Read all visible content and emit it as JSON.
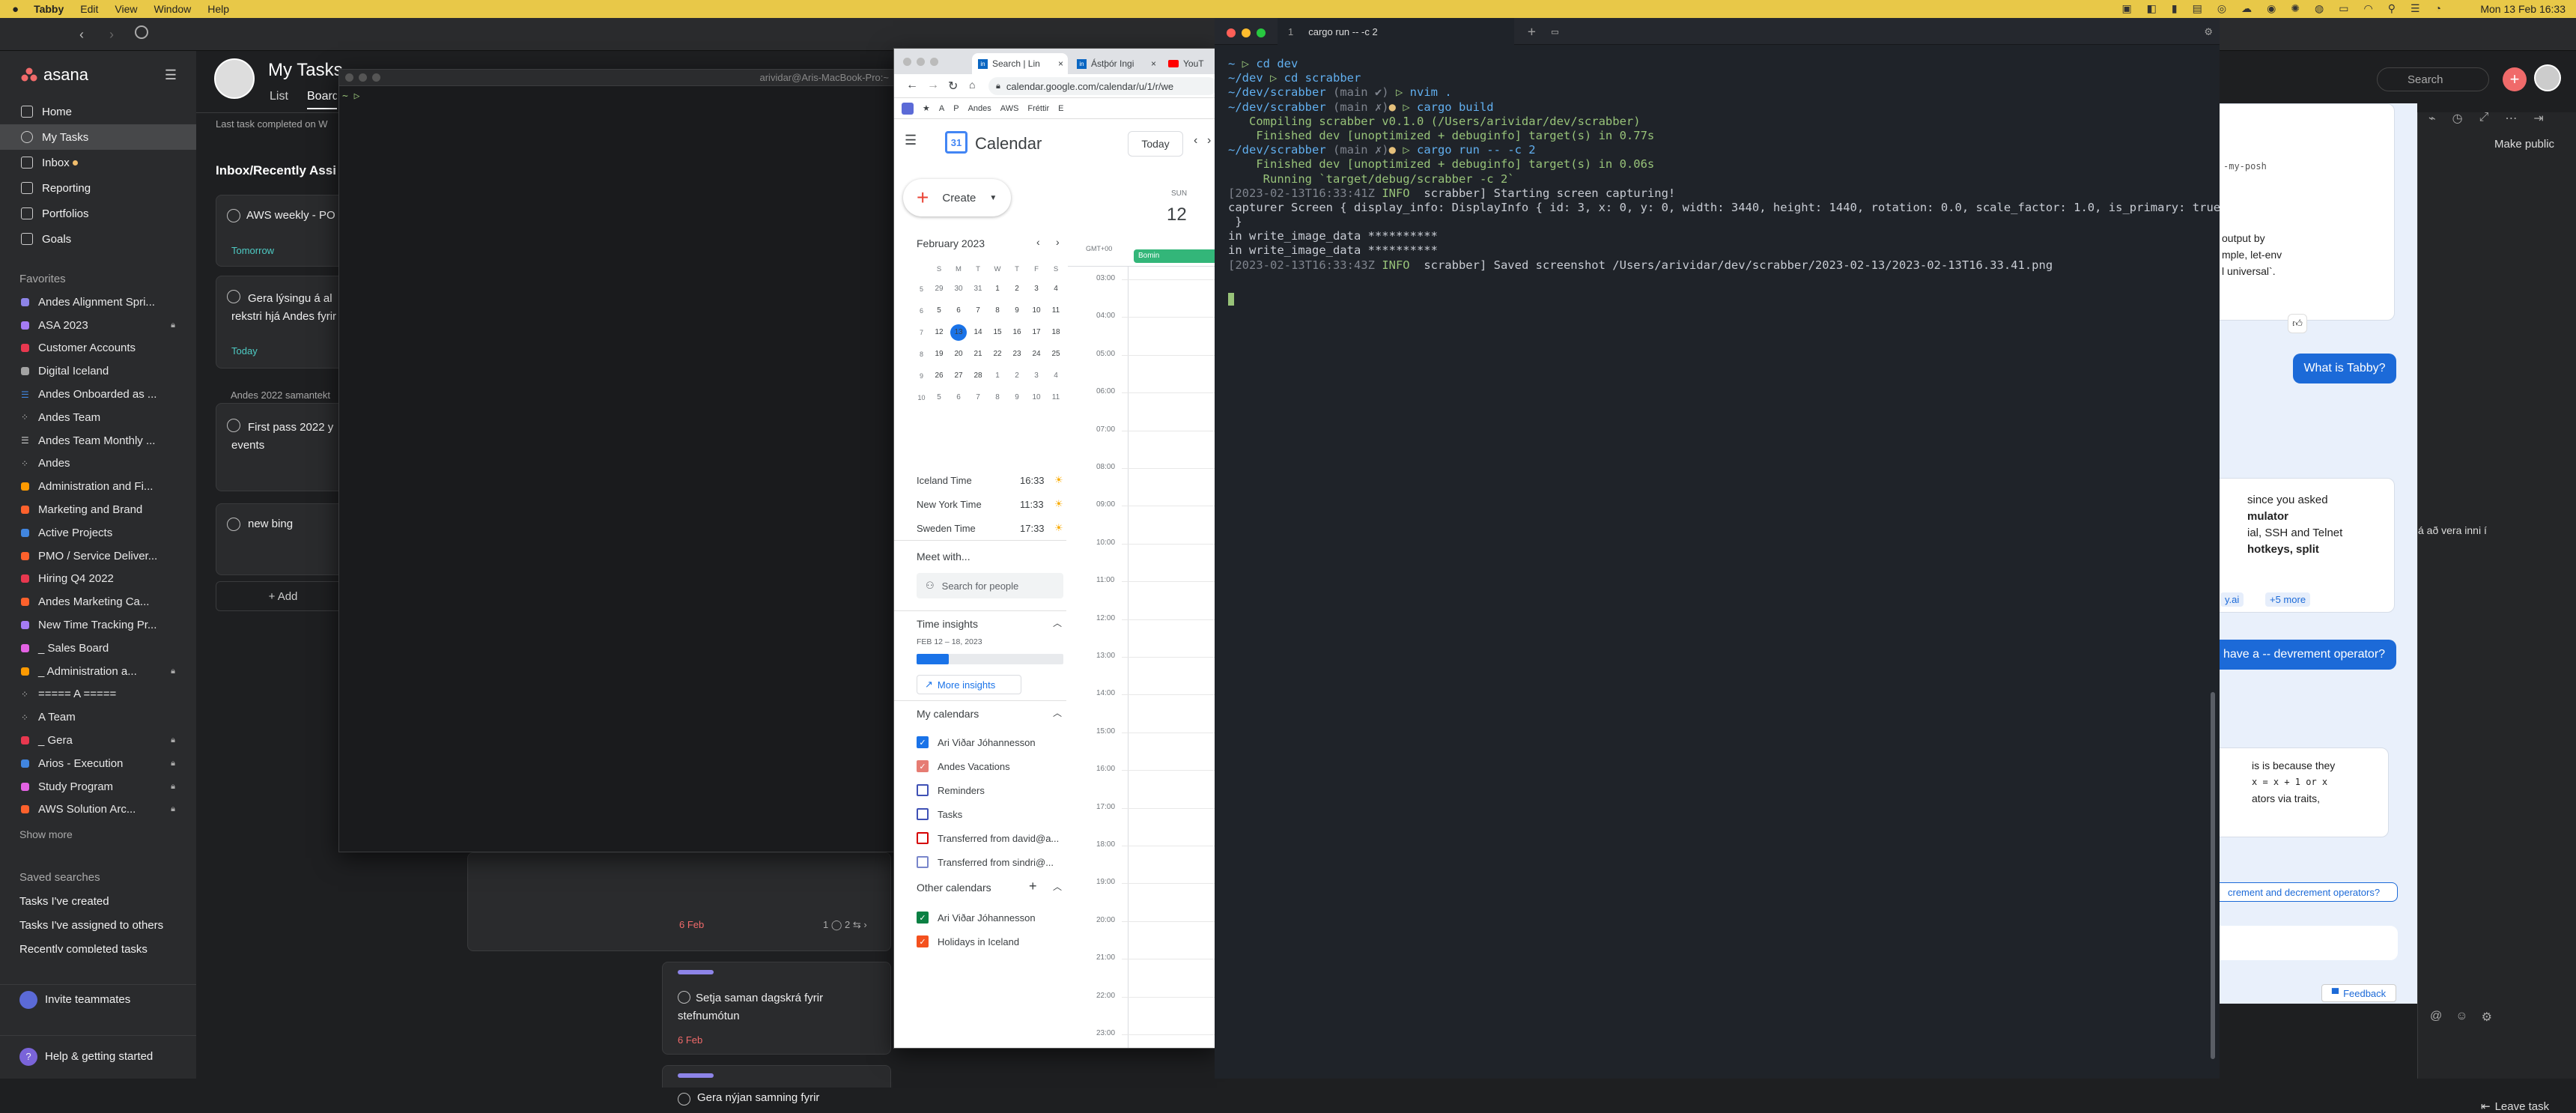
{
  "menubar": {
    "app": "Tabby",
    "items": [
      "Edit",
      "View",
      "Window",
      "Help"
    ],
    "clock": "Mon 13 Feb 16:33"
  },
  "asana": {
    "brand": "asana",
    "page_title": "My Tasks",
    "tabs": [
      "List",
      "Board"
    ],
    "last_completed": "Last task completed on W",
    "search_placeholder": "Search",
    "nav": [
      {
        "label": "Home",
        "icon": "home-icon"
      },
      {
        "label": "My Tasks",
        "icon": "check-circle-icon"
      },
      {
        "label": "Inbox",
        "icon": "bell-icon"
      },
      {
        "label": "Reporting",
        "icon": "chart-icon"
      },
      {
        "label": "Portfolios",
        "icon": "folder-icon"
      },
      {
        "label": "Goals",
        "icon": "person-icon"
      }
    ],
    "favorites_heading": "Favorites",
    "favorites": [
      {
        "label": "Andes Alignment Spri...",
        "color": "#8d84e8",
        "kind": "square"
      },
      {
        "label": "ASA 2023",
        "color": "#a57bf5",
        "kind": "square",
        "lock": true
      },
      {
        "label": "Customer Accounts",
        "color": "#e8384f",
        "kind": "square"
      },
      {
        "label": "Digital Iceland",
        "color": "#a3a3a3",
        "kind": "square"
      },
      {
        "label": "Andes Onboarded as ...",
        "color": "#4186e0",
        "kind": "list"
      },
      {
        "label": "Andes Team",
        "color": "#cccccc",
        "kind": "team"
      },
      {
        "label": "Andes Team Monthly ...",
        "color": "#cccccc",
        "kind": "list"
      },
      {
        "label": "Andes",
        "color": "#cccccc",
        "kind": "team"
      },
      {
        "label": "Administration and Fi...",
        "color": "#fd9a00",
        "kind": "square"
      },
      {
        "label": "Marketing and Brand",
        "color": "#fd612c",
        "kind": "square"
      },
      {
        "label": "Active Projects",
        "color": "#4186e0",
        "kind": "square"
      },
      {
        "label": "PMO / Service Deliver...",
        "color": "#fd612c",
        "kind": "square"
      },
      {
        "label": "Hiring Q4 2022",
        "color": "#e8384f",
        "kind": "square"
      },
      {
        "label": "Andes Marketing Ca...",
        "color": "#fd612c",
        "kind": "square"
      },
      {
        "label": "New Time Tracking Pr...",
        "color": "#a57bf5",
        "kind": "square"
      },
      {
        "label": "_ Sales Board",
        "color": "#e362e3",
        "kind": "square"
      },
      {
        "label": "_ Administration a...",
        "color": "#fd9a00",
        "kind": "square",
        "lock": true
      },
      {
        "label": "===== A =====",
        "color": "#cccccc",
        "kind": "team"
      },
      {
        "label": "A Team",
        "color": "#cccccc",
        "kind": "team"
      },
      {
        "label": "_ Gera",
        "color": "#e8384f",
        "kind": "square",
        "lock": true
      },
      {
        "label": "Arios - Execution",
        "color": "#4186e0",
        "kind": "square",
        "lock": true
      },
      {
        "label": "Study Program",
        "color": "#e362e3",
        "kind": "square",
        "lock": true
      },
      {
        "label": "AWS Solution Arc...",
        "color": "#fd612c",
        "kind": "square",
        "lock": true
      }
    ],
    "show_more": "Show more",
    "saved_heading": "Saved searches",
    "saved": [
      "Tasks I've created",
      "Tasks I've assigned to others",
      "Recently completed tasks"
    ],
    "invite": "Invite teammates",
    "help": "Help & getting started",
    "section1": "Inbox/Recently Assi",
    "section2_label": "Andes 2022 samantekt",
    "cards": [
      {
        "title": "AWS weekly - PO",
        "due": "Tomorrow",
        "due_color": "#4ecbc4"
      },
      {
        "title": "Gera lýsingu á al rekstri hjá Andes fyrir",
        "due": "Today",
        "due_color": "#4ecbc4"
      },
      {
        "title": "First pass 2022 y events",
        "due": "",
        "due_color": ""
      },
      {
        "title": "new bing",
        "due": "",
        "due_color": ""
      }
    ],
    "add_task": "+ Add",
    "lower_cards": [
      {
        "title": "",
        "due": "6 Feb",
        "meta": "1 ◯  2 ⇆ ›"
      },
      {
        "title": "Setja saman dagskrá fyrir stefnumótun",
        "due": "6 Feb",
        "meta": ""
      },
      {
        "title": "Gera nýjan samning fyrir",
        "due": "",
        "meta": ""
      }
    ],
    "make_public": "Make public",
    "leave_task": "Leave task"
  },
  "term1": {
    "title": "arividar@Aris-MacBook-Pro:~",
    "prompt": "~ ▷"
  },
  "chrome": {
    "tabs": [
      "Search | Lin",
      "Ástþór Ingi",
      "YouT"
    ],
    "url": "calendar.google.com/calendar/u/1/r/we",
    "bookmarks": [
      "A",
      "P",
      "Andes",
      "AWS",
      "Fréttir",
      "E"
    ],
    "calendar": {
      "title": "Calendar",
      "today_btn": "Today",
      "create": "Create",
      "day_name": "SUN",
      "day_num": "12",
      "tz": "GMT+00",
      "event": "Bomin",
      "month": "February 2023",
      "weekday_heads": [
        "S",
        "M",
        "T",
        "W",
        "T",
        "F",
        "S"
      ],
      "weeks": [
        {
          "wk": "5",
          "days": [
            "29",
            "30",
            "31",
            "1",
            "2",
            "3",
            "4"
          ]
        },
        {
          "wk": "6",
          "days": [
            "5",
            "6",
            "7",
            "8",
            "9",
            "10",
            "11"
          ]
        },
        {
          "wk": "7",
          "days": [
            "12",
            "13",
            "14",
            "15",
            "16",
            "17",
            "18"
          ]
        },
        {
          "wk": "8",
          "days": [
            "19",
            "20",
            "21",
            "22",
            "23",
            "24",
            "25"
          ]
        },
        {
          "wk": "9",
          "days": [
            "26",
            "27",
            "28",
            "1",
            "2",
            "3",
            "4"
          ]
        },
        {
          "wk": "10",
          "days": [
            "5",
            "6",
            "7",
            "8",
            "9",
            "10",
            "11"
          ]
        }
      ],
      "today_day": "13",
      "hours": [
        "03:00",
        "04:00",
        "05:00",
        "06:00",
        "07:00",
        "08:00",
        "09:00",
        "10:00",
        "11:00",
        "12:00",
        "13:00",
        "14:00",
        "15:00",
        "16:00",
        "17:00",
        "18:00",
        "19:00",
        "20:00",
        "21:00",
        "22:00",
        "23:00"
      ],
      "world_clock": [
        {
          "city": "Iceland Time",
          "time": "16:33"
        },
        {
          "city": "New York Time",
          "time": "11:33"
        },
        {
          "city": "Sweden Time",
          "time": "17:33"
        }
      ],
      "meet_with": "Meet with...",
      "search_people": "Search for people",
      "time_insights": "Time insights",
      "insights_range": "FEB 12 – 18, 2023",
      "insights_fill": 0.22,
      "more_insights": "More insights",
      "my_calendars_heading": "My calendars",
      "my_calendars": [
        {
          "name": "Ari Viðar Jóhannesson",
          "color": "#1a73e8",
          "checked": true
        },
        {
          "name": "Andes Vacations",
          "color": "#e67c73",
          "checked": true
        },
        {
          "name": "Reminders",
          "color": "#3f51b5",
          "checked": false
        },
        {
          "name": "Tasks",
          "color": "#3f51b5",
          "checked": false
        },
        {
          "name": "Transferred from david@a...",
          "color": "#d50000",
          "checked": false
        },
        {
          "name": "Transferred from sindri@...",
          "color": "#7986cb",
          "checked": false
        }
      ],
      "other_calendars_heading": "Other calendars",
      "other_calendars": [
        {
          "name": "Ari Viðar Jóhannesson",
          "color": "#0b8043",
          "checked": true
        },
        {
          "name": "Holidays in Iceland",
          "color": "#f4511e",
          "checked": true
        }
      ]
    }
  },
  "term2": {
    "tab_num": "1",
    "tab_title": "cargo run -- -c 2",
    "lines": [
      [
        {
          "t": "~ ",
          "c": "b"
        },
        {
          "t": "▷ ",
          "c": "g"
        },
        {
          "t": "cd dev",
          "c": "b"
        }
      ],
      [
        {
          "t": "~/dev ",
          "c": "b"
        },
        {
          "t": "▷ ",
          "c": "g"
        },
        {
          "t": "cd scrabber",
          "c": "b"
        }
      ],
      [
        {
          "t": "~/dev/scrabber ",
          "c": "b"
        },
        {
          "t": "(main ✔) ",
          "c": "gr"
        },
        {
          "t": "▷ ",
          "c": "g"
        },
        {
          "t": "nvim .",
          "c": "b"
        }
      ],
      [
        {
          "t": "~/dev/scrabber ",
          "c": "b"
        },
        {
          "t": "(main ✗)",
          "c": "gr"
        },
        {
          "t": "● ",
          "c": "y"
        },
        {
          "t": "▷ ",
          "c": "g"
        },
        {
          "t": "cargo build",
          "c": "b"
        }
      ],
      [
        {
          "t": "   Compiling scrabber v0.1.0 (/Users/arividar/dev/scrabber)",
          "c": "g"
        }
      ],
      [
        {
          "t": "    Finished dev [unoptimized + debuginfo] target(s) in 0.77s",
          "c": "g"
        }
      ],
      [
        {
          "t": "~/dev/scrabber ",
          "c": "b"
        },
        {
          "t": "(main ✗)",
          "c": "gr"
        },
        {
          "t": "● ",
          "c": "y"
        },
        {
          "t": "▷ ",
          "c": "g"
        },
        {
          "t": "cargo run -- -c 2",
          "c": "b"
        }
      ],
      [
        {
          "t": "    Finished dev [unoptimized + debuginfo] target(s) in 0.06s",
          "c": "g"
        }
      ],
      [
        {
          "t": "     Running `target/debug/scrabber -c 2`",
          "c": "g"
        }
      ],
      [
        {
          "t": "[2023-02-13T16:33:41Z ",
          "c": "gr"
        },
        {
          "t": "INFO ",
          "c": "g"
        },
        {
          "t": " scrabber] Starting screen capturing!",
          "c": ""
        }
      ],
      [
        {
          "t": "capturer Screen { display_info: DisplayInfo { id: 3, x: 0, y: 0, width: 3440, height: 1440, rotation: 0.0, scale_factor: 1.0, is_primary: true }",
          "c": ""
        }
      ],
      [
        {
          "t": " }",
          "c": ""
        }
      ],
      [
        {
          "t": "in write_image_data **********",
          "c": ""
        }
      ],
      [
        {
          "t": "in write_image_data **********",
          "c": ""
        }
      ],
      [
        {
          "t": "[2023-02-13T16:33:43Z ",
          "c": "gr"
        },
        {
          "t": "INFO ",
          "c": "g"
        },
        {
          "t": " scrabber] Saved screenshot /Users/arividar/dev/scrabber/2023-02-13/2023-02-13T16.33.41.png",
          "c": ""
        }
      ]
    ]
  },
  "chat": {
    "frag1": "-my-posh ",
    "frag2_lines": [
      "output by",
      "mple, let-env",
      "l universal`."
    ],
    "q1": "What is Tabby?",
    "frag3_lines": [
      "since you asked",
      "mulator",
      "ial, SSH and Telnet",
      "hotkeys, split"
    ],
    "more": "+5 more",
    "link": "y.ai",
    "q2": "have a -- devrement operator?",
    "frag4_lines": [
      "is is because they",
      "x = x + 1 or x",
      "ators via traits,"
    ],
    "suggestion": "crement and decrement operators?",
    "feedback": "Feedback"
  }
}
